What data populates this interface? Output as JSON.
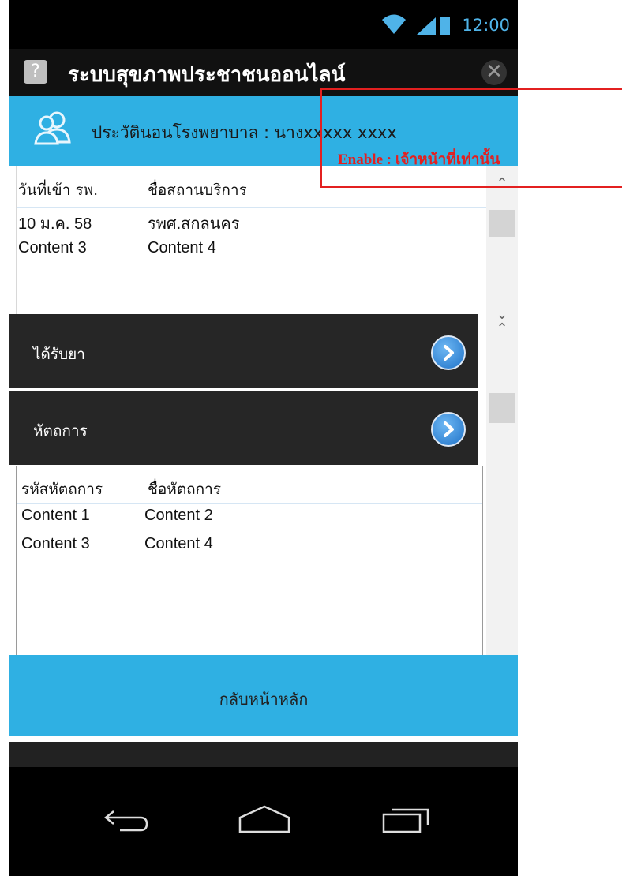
{
  "status_bar": {
    "time": "12:00"
  },
  "app_bar": {
    "title": "ระบบสุขภาพประชาชนออนไลน์",
    "help_icon": "?",
    "close_icon": "close-icon"
  },
  "section_header": {
    "title": "ประวัตินอนโรงพยาบาล : นางxxxxx  xxxx",
    "icon": "users-icon"
  },
  "admissions_table": {
    "columns": [
      "วันที่เข้า รพ.",
      "ชื่อสถานบริการ"
    ],
    "rows": [
      [
        "10 ม.ค. 58",
        "รพศ.สกลนคร"
      ],
      [
        "Content 3",
        "Content 4"
      ]
    ]
  },
  "accordion": [
    {
      "label": "ได้รับยา",
      "icon": "chevron-right-icon"
    },
    {
      "label": "หัตถการ",
      "icon": "chevron-right-icon"
    }
  ],
  "procedures_table": {
    "columns": [
      "รหัสหัตถการ",
      "ชื่อหัตถการ"
    ],
    "rows": [
      [
        "Content 1",
        "Content 2"
      ],
      [
        "Content 3",
        "Content 4"
      ]
    ]
  },
  "home_button": {
    "label": "กลับหน้าหลัก"
  },
  "annotation": {
    "text": "Enable : เจ้าหน้าที่เท่านั้น",
    "color": "#e32020"
  },
  "colors": {
    "accent": "#2fb0e3",
    "dark": "#262626",
    "statusbar_icons": "#4fb3e8"
  }
}
